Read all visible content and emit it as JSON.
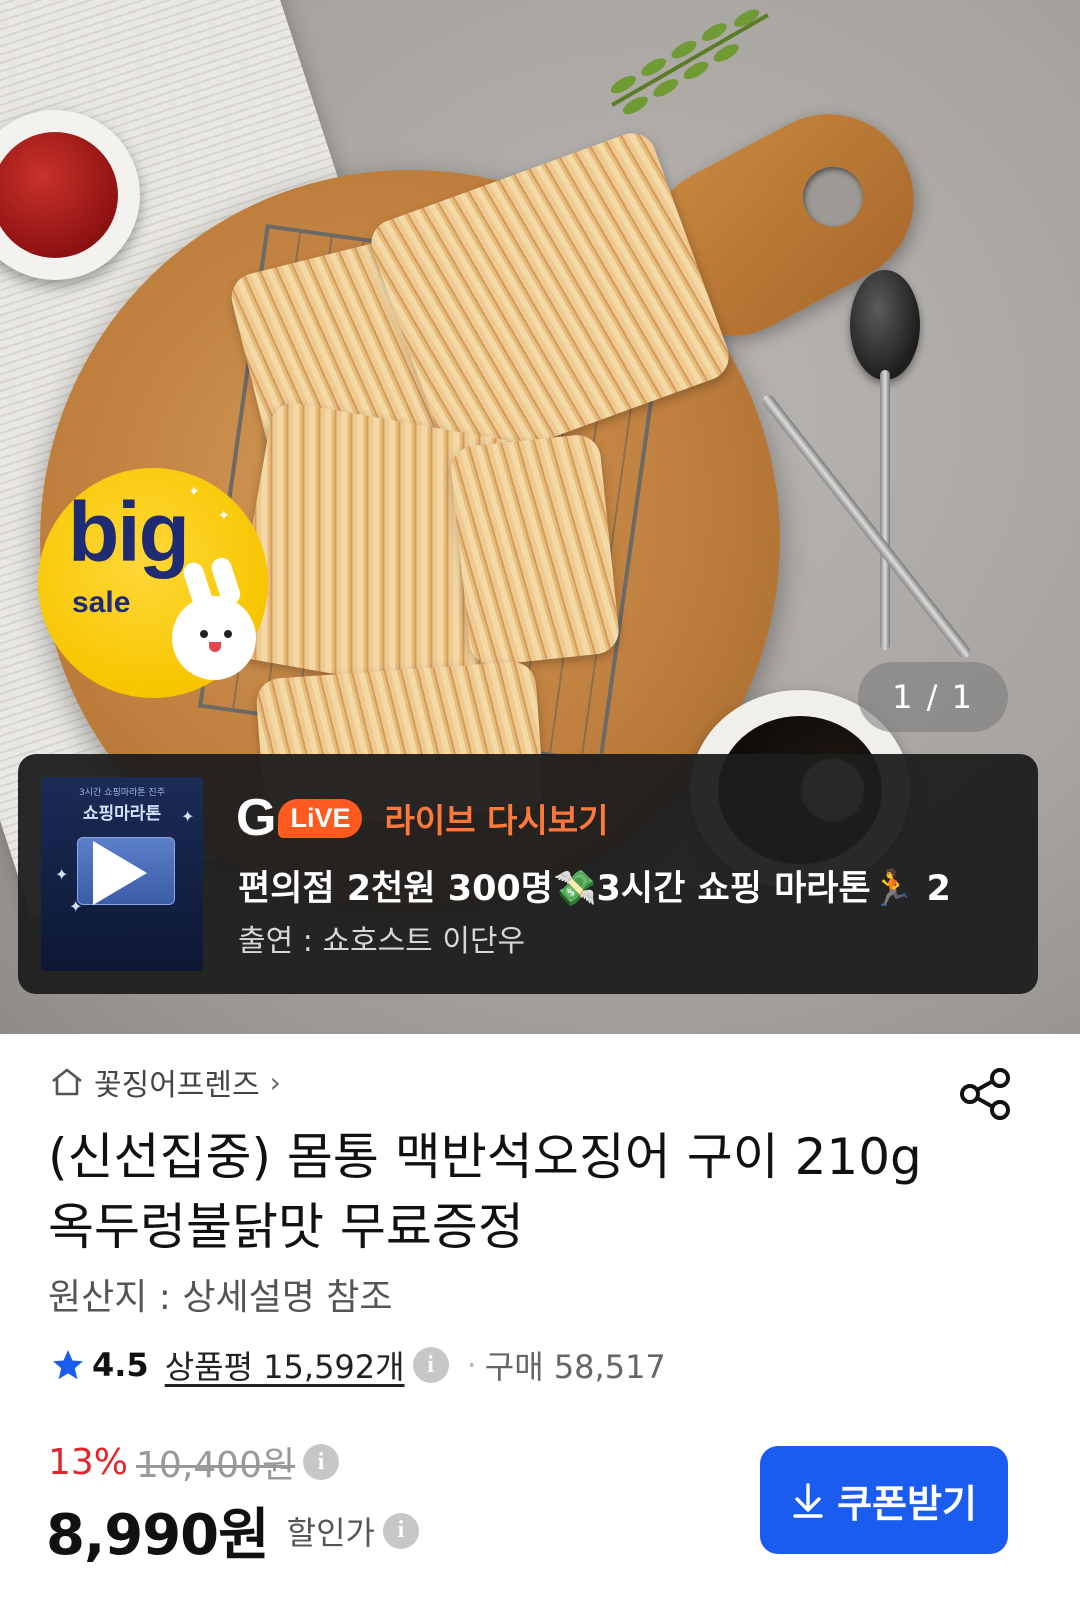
{
  "hero": {
    "badge_big": "big",
    "badge_sale": "sale",
    "image_counter": "1 / 1"
  },
  "live": {
    "thumb_top": "3시간 쇼핑마라톤 진주",
    "thumb_title": "쇼핑마라톤",
    "g_letter": "G",
    "live_label": "LiVE",
    "replay_label": "라이브 다시보기",
    "title": "편의점 2천원 300명💸3시간 쇼핑 마라톤🏃 2",
    "cast": "출연 : 쇼호스트 이단우"
  },
  "product": {
    "store_name": "꽃징어프렌즈",
    "title": "(신선집중) 몸통 맥반석오징어 구이 210g 옥두렁불닭맛 무료증정",
    "origin": "원산지 : 상세설명 참조",
    "rating": "4.5",
    "reviews_label": "상품평 15,592개",
    "bullet": "·",
    "sold_label": "구매 58,517",
    "discount_pct": "13%",
    "original_price": "10,400원",
    "sale_price": "8,990원",
    "sale_price_label": "할인가",
    "coupon_label": "쿠폰받기"
  },
  "colors": {
    "accent_blue": "#1a5cf0",
    "discount_red": "#e0262a",
    "live_orange": "#ff5a1f",
    "star_blue": "#1a5cf0"
  }
}
